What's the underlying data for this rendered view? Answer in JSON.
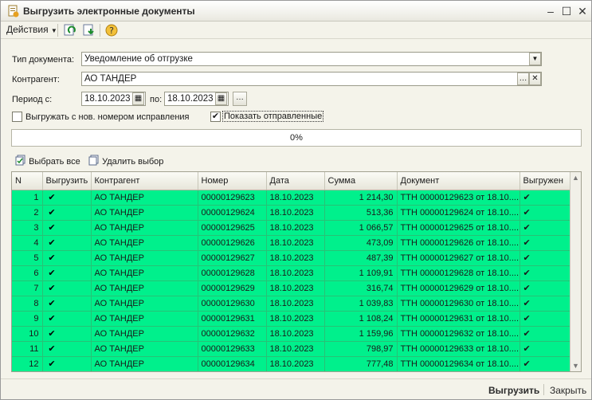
{
  "window": {
    "title": "Выгрузить электронные документы"
  },
  "toolbar": {
    "actions_label": "Действия"
  },
  "form": {
    "doc_type_label": "Тип документа:",
    "doc_type_value": "Уведомление об отгрузке",
    "counterparty_label": "Контрагент:",
    "counterparty_value": "АО ТАНДЕР",
    "period_label": "Период с:",
    "period_from": "18.10.2023",
    "period_to_label": "по:",
    "period_to": "18.10.2023",
    "option_resend_label": "Выгружать с нов. номером исправления",
    "option_show_sent_label": "Показать отправленные",
    "option_resend_checked": false,
    "option_show_sent_checked": true
  },
  "progress": {
    "text": "0%",
    "value": 0
  },
  "selection": {
    "select_all_label": "Выбрать все",
    "clear_selection_label": "Удалить выбор"
  },
  "table": {
    "columns": [
      "N",
      "Выгрузить",
      "Контрагент",
      "Номер",
      "Дата",
      "Сумма",
      "Документ",
      "Выгружен"
    ],
    "rows": [
      {
        "n": "1",
        "counterparty": "АО ТАНДЕР",
        "number": "00000129623",
        "date": "18.10.2023",
        "sum": "1 214,30",
        "document": "ТТН 00000129623 от 18.10...."
      },
      {
        "n": "2",
        "counterparty": "АО ТАНДЕР",
        "number": "00000129624",
        "date": "18.10.2023",
        "sum": "513,36",
        "document": "ТТН 00000129624 от 18.10...."
      },
      {
        "n": "3",
        "counterparty": "АО ТАНДЕР",
        "number": "00000129625",
        "date": "18.10.2023",
        "sum": "1 066,57",
        "document": "ТТН 00000129625 от 18.10...."
      },
      {
        "n": "4",
        "counterparty": "АО ТАНДЕР",
        "number": "00000129626",
        "date": "18.10.2023",
        "sum": "473,09",
        "document": "ТТН 00000129626 от 18.10...."
      },
      {
        "n": "5",
        "counterparty": "АО ТАНДЕР",
        "number": "00000129627",
        "date": "18.10.2023",
        "sum": "487,39",
        "document": "ТТН 00000129627 от 18.10...."
      },
      {
        "n": "6",
        "counterparty": "АО ТАНДЕР",
        "number": "00000129628",
        "date": "18.10.2023",
        "sum": "1 109,91",
        "document": "ТТН 00000129628 от 18.10...."
      },
      {
        "n": "7",
        "counterparty": "АО ТАНДЕР",
        "number": "00000129629",
        "date": "18.10.2023",
        "sum": "316,74",
        "document": "ТТН 00000129629 от 18.10...."
      },
      {
        "n": "8",
        "counterparty": "АО ТАНДЕР",
        "number": "00000129630",
        "date": "18.10.2023",
        "sum": "1 039,83",
        "document": "ТТН 00000129630 от 18.10...."
      },
      {
        "n": "9",
        "counterparty": "АО ТАНДЕР",
        "number": "00000129631",
        "date": "18.10.2023",
        "sum": "1 108,24",
        "document": "ТТН 00000129631 от 18.10...."
      },
      {
        "n": "10",
        "counterparty": "АО ТАНДЕР",
        "number": "00000129632",
        "date": "18.10.2023",
        "sum": "1 159,96",
        "document": "ТТН 00000129632 от 18.10...."
      },
      {
        "n": "11",
        "counterparty": "АО ТАНДЕР",
        "number": "00000129633",
        "date": "18.10.2023",
        "sum": "798,97",
        "document": "ТТН 00000129633 от 18.10...."
      },
      {
        "n": "12",
        "counterparty": "АО ТАНДЕР",
        "number": "00000129634",
        "date": "18.10.2023",
        "sum": "777,48",
        "document": "ТТН 00000129634 от 18.10...."
      }
    ]
  },
  "footer": {
    "export_label": "Выгрузить",
    "close_label": "Закрыть"
  },
  "colors": {
    "row_bg": "#00f08c",
    "window_bg": "#f4f3ea"
  },
  "icons": [
    "document-icon",
    "refresh-icon",
    "download-icon",
    "help-icon",
    "calendar-icon",
    "select-all-icon",
    "clear-selection-icon"
  ]
}
